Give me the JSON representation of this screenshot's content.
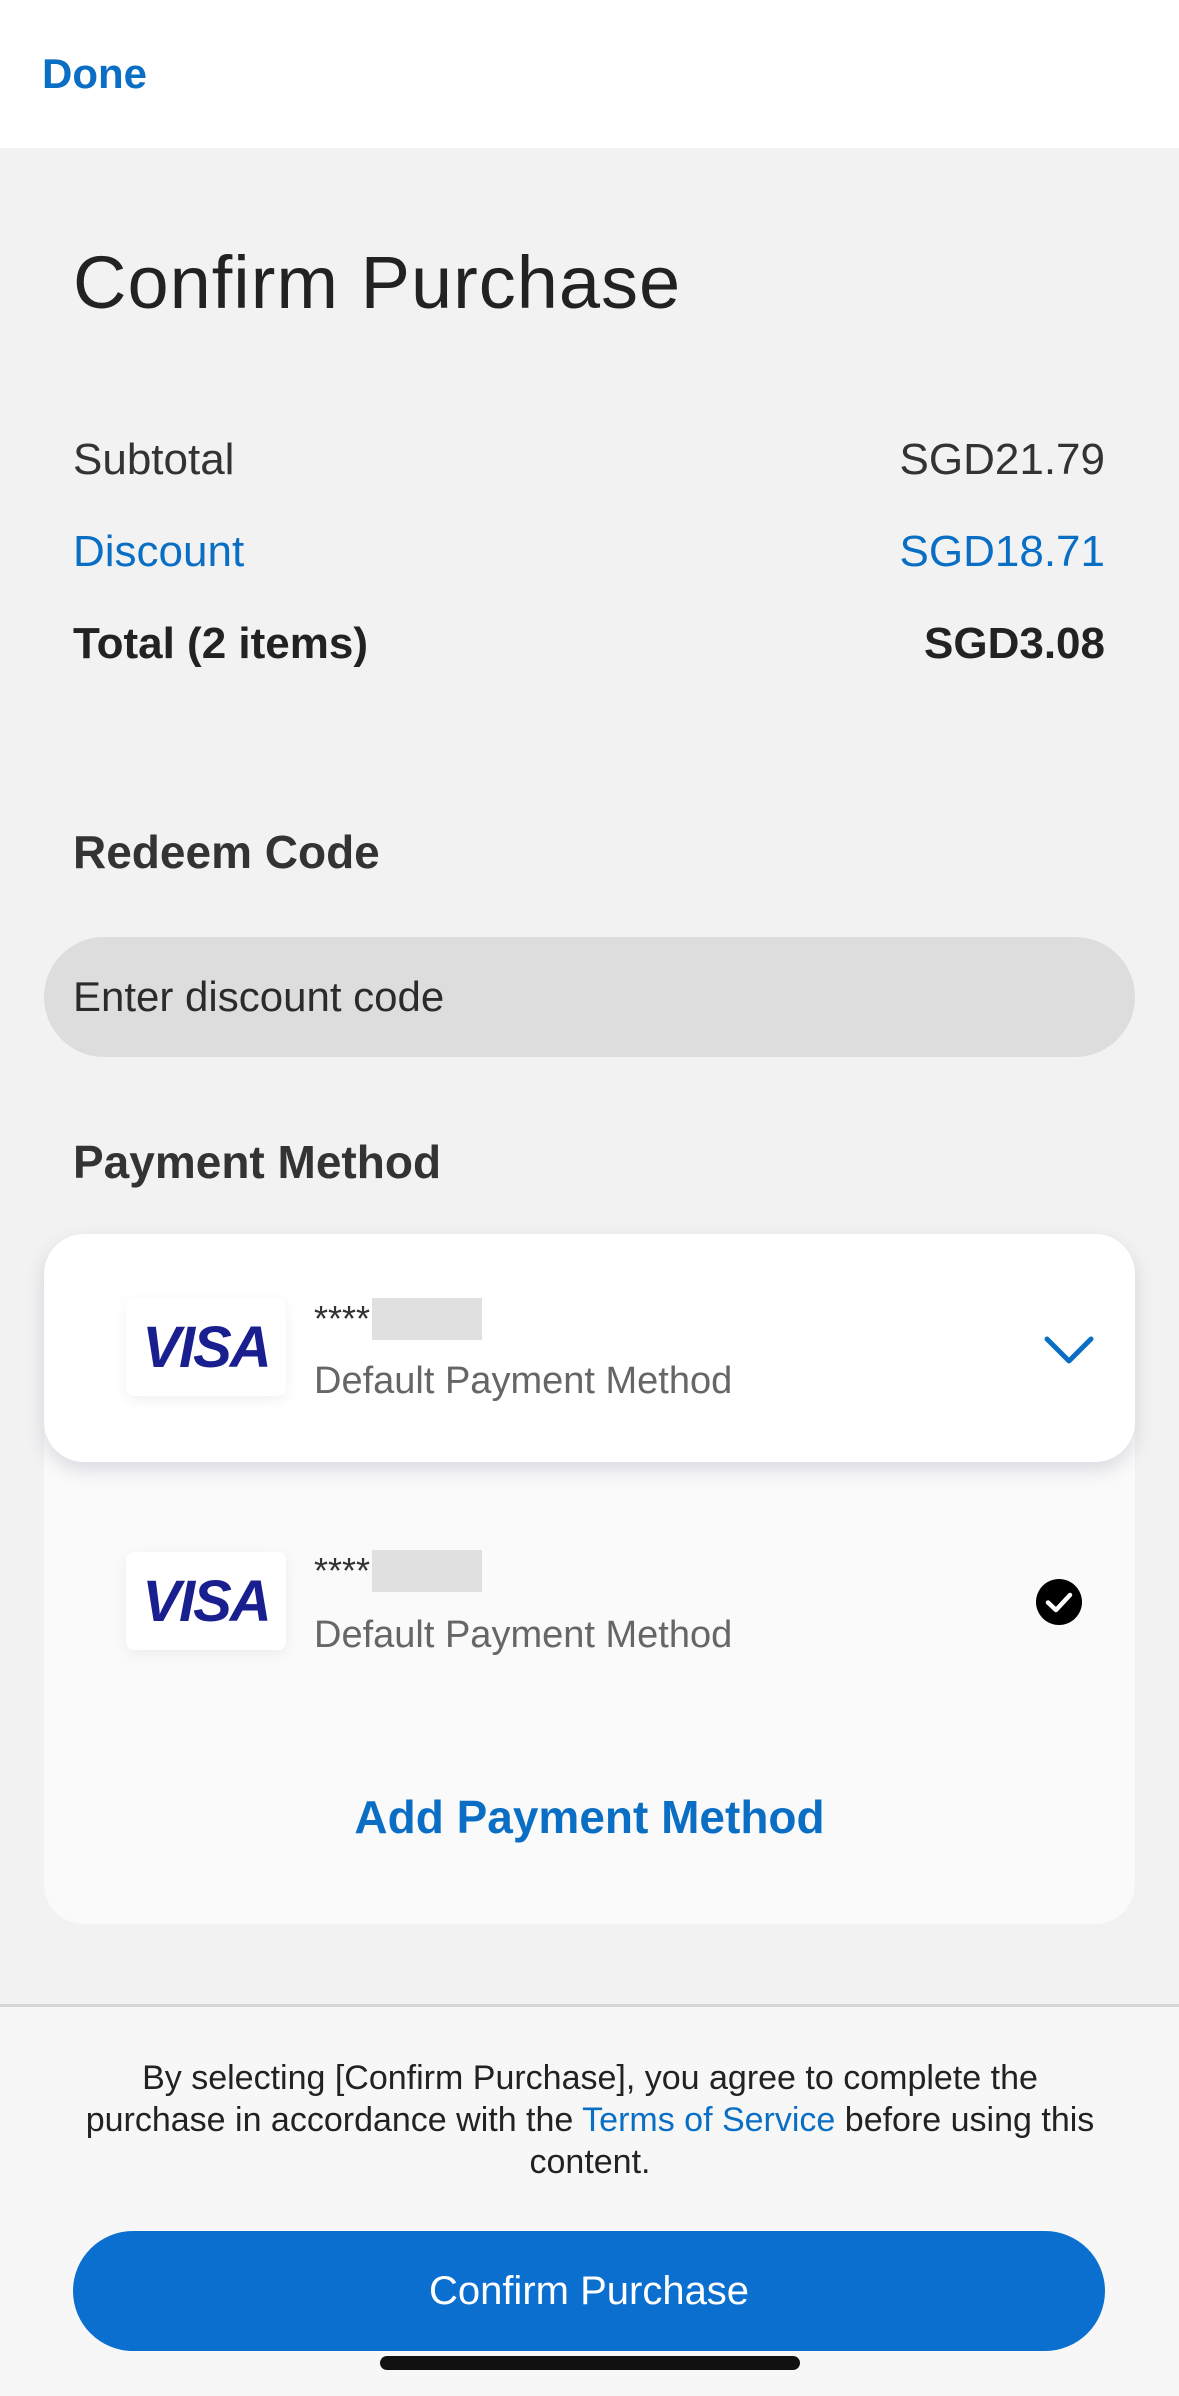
{
  "header": {
    "done_label": "Done"
  },
  "page": {
    "title": "Confirm Purchase"
  },
  "summary": {
    "subtotal_label": "Subtotal",
    "subtotal_value": "SGD21.79",
    "discount_label": "Discount",
    "discount_value": "SGD18.71",
    "total_label": "Total (2 items)",
    "total_value": "SGD3.08"
  },
  "redeem": {
    "label": "Redeem Code",
    "placeholder": "Enter discount code",
    "value": ""
  },
  "payment": {
    "label": "Payment Method",
    "methods": [
      {
        "brand": "VISA",
        "masked_number": "****",
        "subtitle": "Default Payment Method",
        "state": "collapsed-selector"
      },
      {
        "brand": "VISA",
        "masked_number": "****",
        "subtitle": "Default Payment Method",
        "state": "selected"
      }
    ],
    "add_label": "Add Payment Method"
  },
  "footer": {
    "legal_prefix": "By selecting [Confirm Purchase], you agree to complete the purchase in accordance with the ",
    "legal_link": "Terms of Service",
    "legal_suffix": " before using this content.",
    "confirm_label": "Confirm Purchase"
  },
  "colors": {
    "accent": "#0a6fc4",
    "button": "#0a6fcf",
    "visa": "#1a1f8f"
  },
  "icons": {
    "expand": "chevron-down-icon",
    "selected": "checkmark-circle-icon"
  }
}
